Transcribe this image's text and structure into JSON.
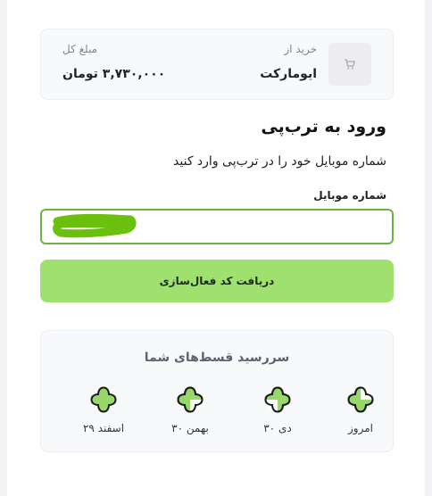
{
  "merchant": {
    "buy_from_label": "خرید از",
    "name": "ایومارکت",
    "total_label": "مبلغ کل",
    "total_value": "۳,۷۳۰,۰۰۰ تومان",
    "thumb_icon": "cart-icon"
  },
  "login": {
    "title": "ورود به ترب‌پی",
    "subtitle": "شماره موبایل خود را در ترب‌پی وارد کنید",
    "phone_label": "شماره موبایل",
    "phone_value": "",
    "submit_label": "دریافت کد فعال‌سازی"
  },
  "installments": {
    "title": "سررسید قسط‌های شما",
    "items": [
      {
        "label": "امروز",
        "fill": 0.25
      },
      {
        "label": "۳۰ دی",
        "fill": 0.5
      },
      {
        "label": "۳۰ بهمن",
        "fill": 0.75
      },
      {
        "label": "۲۹ اسفند",
        "fill": 1.0
      }
    ]
  },
  "colors": {
    "accent": "#6db33f",
    "button": "#9fe06f",
    "clover_fill": "#98d86a",
    "clover_stroke": "#1a1a1a"
  }
}
